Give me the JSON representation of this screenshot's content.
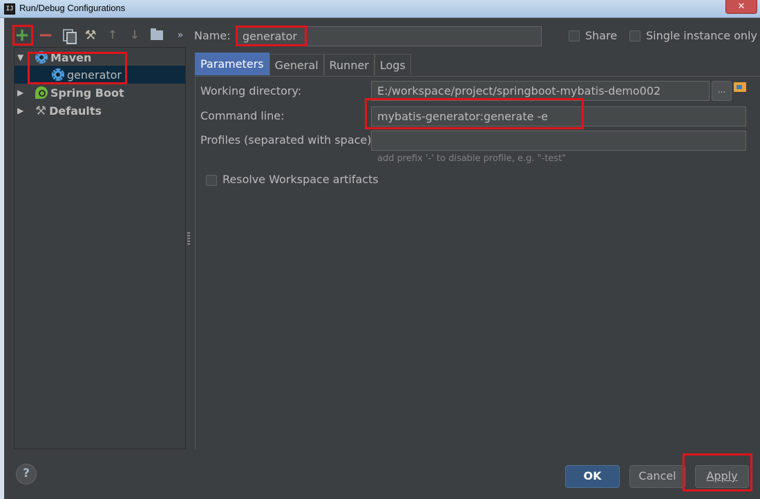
{
  "window": {
    "title": "Run/Debug Configurations",
    "close_label": "✕"
  },
  "toolbar": {
    "more_label": "»"
  },
  "tree": {
    "items": [
      {
        "label": "Maven",
        "expanded": true
      },
      {
        "label": "generator",
        "selected": true
      },
      {
        "label": "Spring Boot",
        "expanded": false
      },
      {
        "label": "Defaults",
        "expanded": false
      }
    ]
  },
  "form": {
    "name_label": "Name:",
    "name_value": "generator",
    "share_label": "Share",
    "single_instance_label": "Single instance only"
  },
  "tabs": [
    {
      "label": "Parameters",
      "active": true
    },
    {
      "label": "General"
    },
    {
      "label": "Runner"
    },
    {
      "label": "Logs"
    }
  ],
  "parameters": {
    "working_directory_label": "Working directory:",
    "working_directory_value": "E:/workspace/project/springboot-mybatis-demo002",
    "browse_label": "...",
    "command_line_label": "Command line:",
    "command_line_value": "mybatis-generator:generate -e",
    "profiles_label": "Profiles (separated with space):",
    "profiles_value": "",
    "profiles_hint": "add prefix '-' to disable profile, e.g. \"-test\"",
    "resolve_workspace_label": "Resolve Workspace artifacts"
  },
  "buttons": {
    "help_label": "?",
    "ok_label": "OK",
    "cancel_label": "Cancel",
    "apply_label": "Apply"
  },
  "colors": {
    "background": "#3c3f41",
    "accent": "#4b6eaf",
    "highlight": "#e0141b",
    "selection": "#0d293e"
  }
}
